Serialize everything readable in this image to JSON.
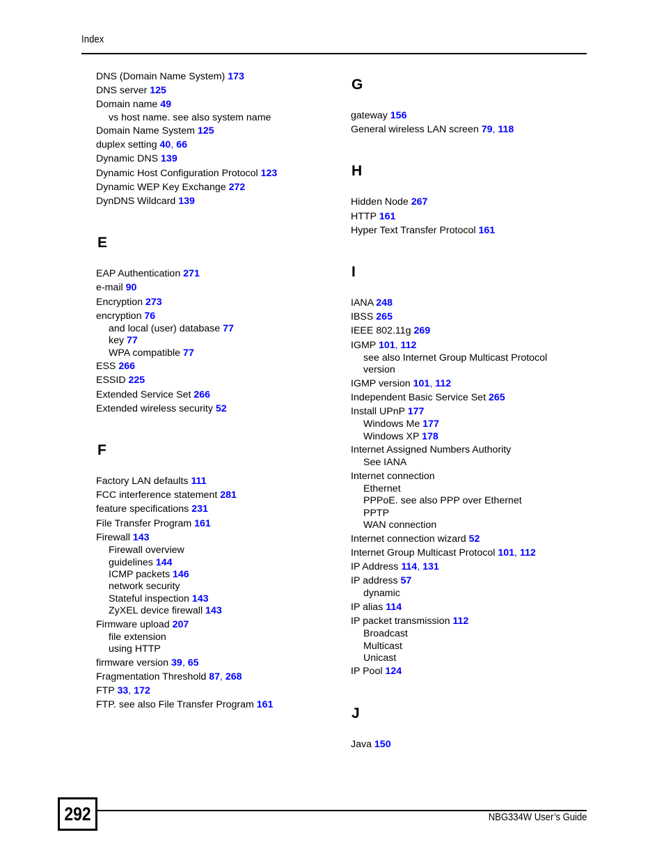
{
  "header": {
    "title": "Index"
  },
  "footer": {
    "page_number": "292",
    "guide_title": "NBG334W User’s Guide"
  },
  "colors": {
    "page_reference": "#0000ff",
    "text": "#000000",
    "background": "#ffffff"
  },
  "columns": {
    "left": [
      {
        "type": "entries",
        "items": [
          {
            "label": "DNS (Domain Name System)",
            "pages": [
              "173"
            ],
            "level": 0
          },
          {
            "label": "DNS server",
            "pages": [
              "125"
            ],
            "level": 0
          },
          {
            "label": "Domain name",
            "pages": [
              "49"
            ],
            "level": 0
          },
          {
            "label": "vs host name. see also system name",
            "pages": [],
            "level": 1
          },
          {
            "label": "Domain Name System",
            "pages": [
              "125"
            ],
            "level": 0
          },
          {
            "label": "duplex setting",
            "pages": [
              "40",
              "66"
            ],
            "level": 0
          },
          {
            "label": "Dynamic DNS",
            "pages": [
              "139"
            ],
            "level": 0
          },
          {
            "label": "Dynamic Host Configuration Protocol",
            "pages": [
              "123"
            ],
            "level": 0
          },
          {
            "label": "Dynamic WEP Key Exchange",
            "pages": [
              "272"
            ],
            "level": 0
          },
          {
            "label": "DynDNS Wildcard",
            "pages": [
              "139"
            ],
            "level": 0
          }
        ]
      },
      {
        "type": "section",
        "letter": "E",
        "items": [
          {
            "label": "EAP Authentication",
            "pages": [
              "271"
            ],
            "level": 0
          },
          {
            "label": "e-mail",
            "pages": [
              "90"
            ],
            "level": 0
          },
          {
            "label": "Encryption",
            "pages": [
              "273"
            ],
            "level": 0
          },
          {
            "label": "encryption",
            "pages": [
              "76"
            ],
            "level": 0
          },
          {
            "label": "and local (user) database",
            "pages": [
              "77"
            ],
            "level": 1
          },
          {
            "label": "key",
            "pages": [
              "77"
            ],
            "level": 1
          },
          {
            "label": "WPA compatible",
            "pages": [
              "77"
            ],
            "level": 1
          },
          {
            "label": "ESS",
            "pages": [
              "266"
            ],
            "level": 0
          },
          {
            "label": "ESSID",
            "pages": [
              "225"
            ],
            "level": 0
          },
          {
            "label": "Extended Service Set",
            "pages": [
              "266"
            ],
            "level": 0
          },
          {
            "label": "Extended wireless security",
            "pages": [
              "52"
            ],
            "level": 0
          }
        ]
      },
      {
        "type": "section",
        "letter": "F",
        "items": [
          {
            "label": "Factory LAN defaults",
            "pages": [
              "111"
            ],
            "level": 0
          },
          {
            "label": "FCC interference statement",
            "pages": [
              "281"
            ],
            "level": 0
          },
          {
            "label": "feature specifications",
            "pages": [
              "231"
            ],
            "level": 0
          },
          {
            "label": "File Transfer Program",
            "pages": [
              "161"
            ],
            "level": 0
          },
          {
            "label": "Firewall",
            "pages": [
              "143"
            ],
            "level": 0
          },
          {
            "label": "Firewall overview",
            "pages": [],
            "level": 1
          },
          {
            "label": "guidelines",
            "pages": [
              "144"
            ],
            "level": 1
          },
          {
            "label": "ICMP packets",
            "pages": [
              "146"
            ],
            "level": 1
          },
          {
            "label": "network security",
            "pages": [],
            "level": 1
          },
          {
            "label": "Stateful inspection",
            "pages": [
              "143"
            ],
            "level": 1
          },
          {
            "label": "ZyXEL device firewall",
            "pages": [
              "143"
            ],
            "level": 1
          },
          {
            "label": "Firmware upload",
            "pages": [
              "207"
            ],
            "level": 0
          },
          {
            "label": "file extension",
            "pages": [],
            "level": 1
          },
          {
            "label": "using HTTP",
            "pages": [],
            "level": 1
          },
          {
            "label": "firmware version",
            "pages": [
              "39",
              "65"
            ],
            "level": 0
          },
          {
            "label": "Fragmentation Threshold",
            "pages": [
              "87",
              "268"
            ],
            "level": 0
          },
          {
            "label": "FTP",
            "pages": [
              "33",
              "172"
            ],
            "level": 0
          },
          {
            "label": "FTP. see also File Transfer Program",
            "pages": [
              "161"
            ],
            "level": 0
          }
        ]
      }
    ],
    "right": [
      {
        "type": "section",
        "letter": "G",
        "items": [
          {
            "label": "gateway",
            "pages": [
              "156"
            ],
            "level": 0
          },
          {
            "label": "General wireless LAN screen",
            "pages": [
              "79",
              "118"
            ],
            "level": 0
          }
        ]
      },
      {
        "type": "section",
        "letter": "H",
        "items": [
          {
            "label": "Hidden Node",
            "pages": [
              "267"
            ],
            "level": 0
          },
          {
            "label": "HTTP",
            "pages": [
              "161"
            ],
            "level": 0
          },
          {
            "label": "Hyper Text Transfer Protocol",
            "pages": [
              "161"
            ],
            "level": 0
          }
        ]
      },
      {
        "type": "section",
        "letter": "I",
        "items": [
          {
            "label": "IANA",
            "pages": [
              "248"
            ],
            "level": 0
          },
          {
            "label": "IBSS",
            "pages": [
              "265"
            ],
            "level": 0
          },
          {
            "label": "IEEE 802.11g",
            "pages": [
              "269"
            ],
            "level": 0
          },
          {
            "label": "IGMP",
            "pages": [
              "101",
              "112"
            ],
            "level": 0
          },
          {
            "label": "see also Internet Group Multicast Protocol",
            "pages": [],
            "level": 1
          },
          {
            "label": "version",
            "pages": [],
            "level": 1
          },
          {
            "label": "IGMP version",
            "pages": [
              "101",
              "112"
            ],
            "level": 0
          },
          {
            "label": "Independent Basic Service Set",
            "pages": [
              "265"
            ],
            "level": 0
          },
          {
            "label": "Install UPnP",
            "pages": [
              "177"
            ],
            "level": 0
          },
          {
            "label": "Windows Me",
            "pages": [
              "177"
            ],
            "level": 1
          },
          {
            "label": "Windows XP",
            "pages": [
              "178"
            ],
            "level": 1
          },
          {
            "label": "Internet Assigned Numbers Authority",
            "pages": [],
            "level": 0
          },
          {
            "label": "See IANA",
            "pages": [],
            "level": 1
          },
          {
            "label": "Internet connection",
            "pages": [],
            "level": 0
          },
          {
            "label": "Ethernet",
            "pages": [],
            "level": 1
          },
          {
            "label": "PPPoE. see also PPP over Ethernet",
            "pages": [],
            "level": 1
          },
          {
            "label": "PPTP",
            "pages": [],
            "level": 1
          },
          {
            "label": "WAN connection",
            "pages": [],
            "level": 1
          },
          {
            "label": "Internet connection wizard",
            "pages": [
              "52"
            ],
            "level": 0
          },
          {
            "label": "Internet Group Multicast Protocol",
            "pages": [
              "101",
              "112"
            ],
            "level": 0
          },
          {
            "label": "IP Address",
            "pages": [
              "114",
              "131"
            ],
            "level": 0
          },
          {
            "label": "IP address",
            "pages": [
              "57"
            ],
            "level": 0
          },
          {
            "label": "dynamic",
            "pages": [],
            "level": 1
          },
          {
            "label": "IP alias",
            "pages": [
              "114"
            ],
            "level": 0
          },
          {
            "label": "IP packet transmission",
            "pages": [
              "112"
            ],
            "level": 0
          },
          {
            "label": "Broadcast",
            "pages": [],
            "level": 1
          },
          {
            "label": "Multicast",
            "pages": [],
            "level": 1
          },
          {
            "label": "Unicast",
            "pages": [],
            "level": 1
          },
          {
            "label": "IP Pool",
            "pages": [
              "124"
            ],
            "level": 0
          }
        ]
      },
      {
        "type": "section",
        "letter": "J",
        "items": [
          {
            "label": "Java",
            "pages": [
              "150"
            ],
            "level": 0
          }
        ]
      }
    ]
  }
}
